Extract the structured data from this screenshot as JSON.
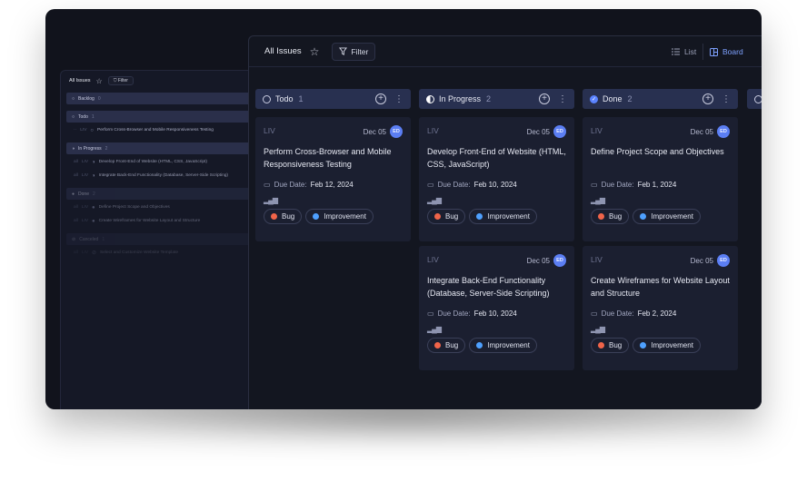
{
  "colors": {
    "accent": "#7ea1ff",
    "bug": "#f06449",
    "improvement": "#4ea0ff",
    "avatar": "#5b7ef3"
  },
  "mini": {
    "title": "All Issues",
    "filter": "Filter",
    "groups": [
      {
        "label": "Backlog",
        "count": "0",
        "rows": []
      },
      {
        "label": "Todo",
        "count": "1",
        "rows": [
          {
            "key": "LIV",
            "text": "Perform Cross-Browser and Mobile Responsiveness Testing"
          }
        ]
      },
      {
        "label": "In Progress",
        "count": "2",
        "rows": [
          {
            "key": "LIV",
            "text": "Develop Front-End of Website (HTML, CSS, JavaScript)"
          },
          {
            "key": "LIV",
            "text": "Integrate Back-End Functionality (Database, Server-Side Scripting)"
          }
        ]
      },
      {
        "label": "Done",
        "count": "2",
        "rows": [
          {
            "key": "LIV",
            "text": "Define Project Scope and Objectives"
          },
          {
            "key": "LIV",
            "text": "Create Wireframes for Website Layout and Structure"
          }
        ]
      },
      {
        "label": "Canceled",
        "count": "1",
        "rows": [
          {
            "key": "LIV",
            "text": "Select and Customize Website Template"
          }
        ]
      }
    ]
  },
  "header": {
    "title": "All Issues",
    "filter_label": "Filter",
    "list_label": "List",
    "board_label": "Board"
  },
  "columns": [
    {
      "label": "Todo",
      "count": "1",
      "icon": "todo-circle-icon",
      "cards": [
        {
          "project": "LIV",
          "date": "Dec 05",
          "avatar": "ED",
          "title": "Perform Cross-Browser and Mobile Responsiveness Testing",
          "due_label": "Due Date:",
          "due": "Feb 12, 2024",
          "tags": [
            "Bug",
            "Improvement"
          ]
        }
      ]
    },
    {
      "label": "In Progress",
      "count": "2",
      "icon": "in-progress-icon",
      "cards": [
        {
          "project": "LIV",
          "date": "Dec 05",
          "avatar": "ED",
          "title": "Develop Front-End of Website (HTML, CSS, JavaScript)",
          "due_label": "Due Date:",
          "due": "Feb 10, 2024",
          "tags": [
            "Bug",
            "Improvement"
          ]
        },
        {
          "project": "LIV",
          "date": "Dec 05",
          "avatar": "ED",
          "title": "Integrate Back-End Functionality (Database, Server-Side Scripting)",
          "due_label": "Due Date:",
          "due": "Feb 10, 2024",
          "tags": [
            "Bug",
            "Improvement"
          ]
        }
      ]
    },
    {
      "label": "Done",
      "count": "2",
      "icon": "done-check-icon",
      "cards": [
        {
          "project": "LIV",
          "date": "Dec 05",
          "avatar": "ED",
          "title": "Define Project Scope and Objectives",
          "due_label": "Due Date:",
          "due": "Feb 1, 2024",
          "tags": [
            "Bug",
            "Improvement"
          ]
        },
        {
          "project": "LIV",
          "date": "Dec 05",
          "avatar": "ED",
          "title": "Create Wireframes for Website Layout and Structure",
          "due_label": "Due Date:",
          "due": "Feb 2, 2024",
          "tags": [
            "Bug",
            "Improvement"
          ]
        }
      ]
    }
  ]
}
